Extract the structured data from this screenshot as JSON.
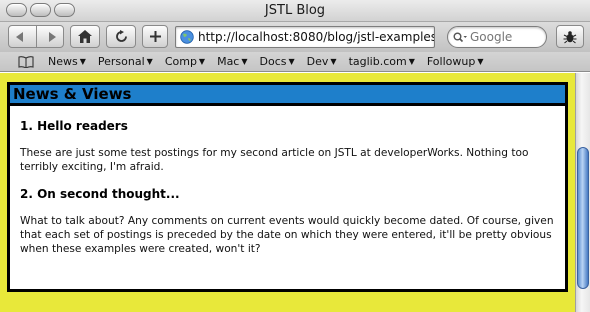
{
  "window": {
    "title": "JSTL Blog"
  },
  "toolbar": {
    "url": "http://localhost:8080/blog/jstl-examples",
    "search_placeholder": "Google"
  },
  "bookmarks": [
    {
      "label": "News",
      "has_menu": true
    },
    {
      "label": "Personal",
      "has_menu": true
    },
    {
      "label": "Comp",
      "has_menu": true
    },
    {
      "label": "Mac",
      "has_menu": true
    },
    {
      "label": "Docs",
      "has_menu": true
    },
    {
      "label": "Dev",
      "has_menu": true
    },
    {
      "label": "taglib.com",
      "has_menu": true
    },
    {
      "label": "Followup",
      "has_menu": true
    }
  ],
  "page": {
    "background_color": "#e8e83a",
    "header_color": "#1e7fcb",
    "section_title": "News & Views",
    "posts": [
      {
        "title": "1. Hello readers",
        "body": "These are just some test postings for my second article on JSTL at developerWorks. Nothing too terribly exciting, I'm afraid."
      },
      {
        "title": "2. On second thought...",
        "body": "What to talk about? Any comments on current events would quickly become dated. Of course, given that each set of postings is preceded by the date on which they were entered, it'll be pretty obvious when these examples were created, won't it?"
      }
    ]
  }
}
